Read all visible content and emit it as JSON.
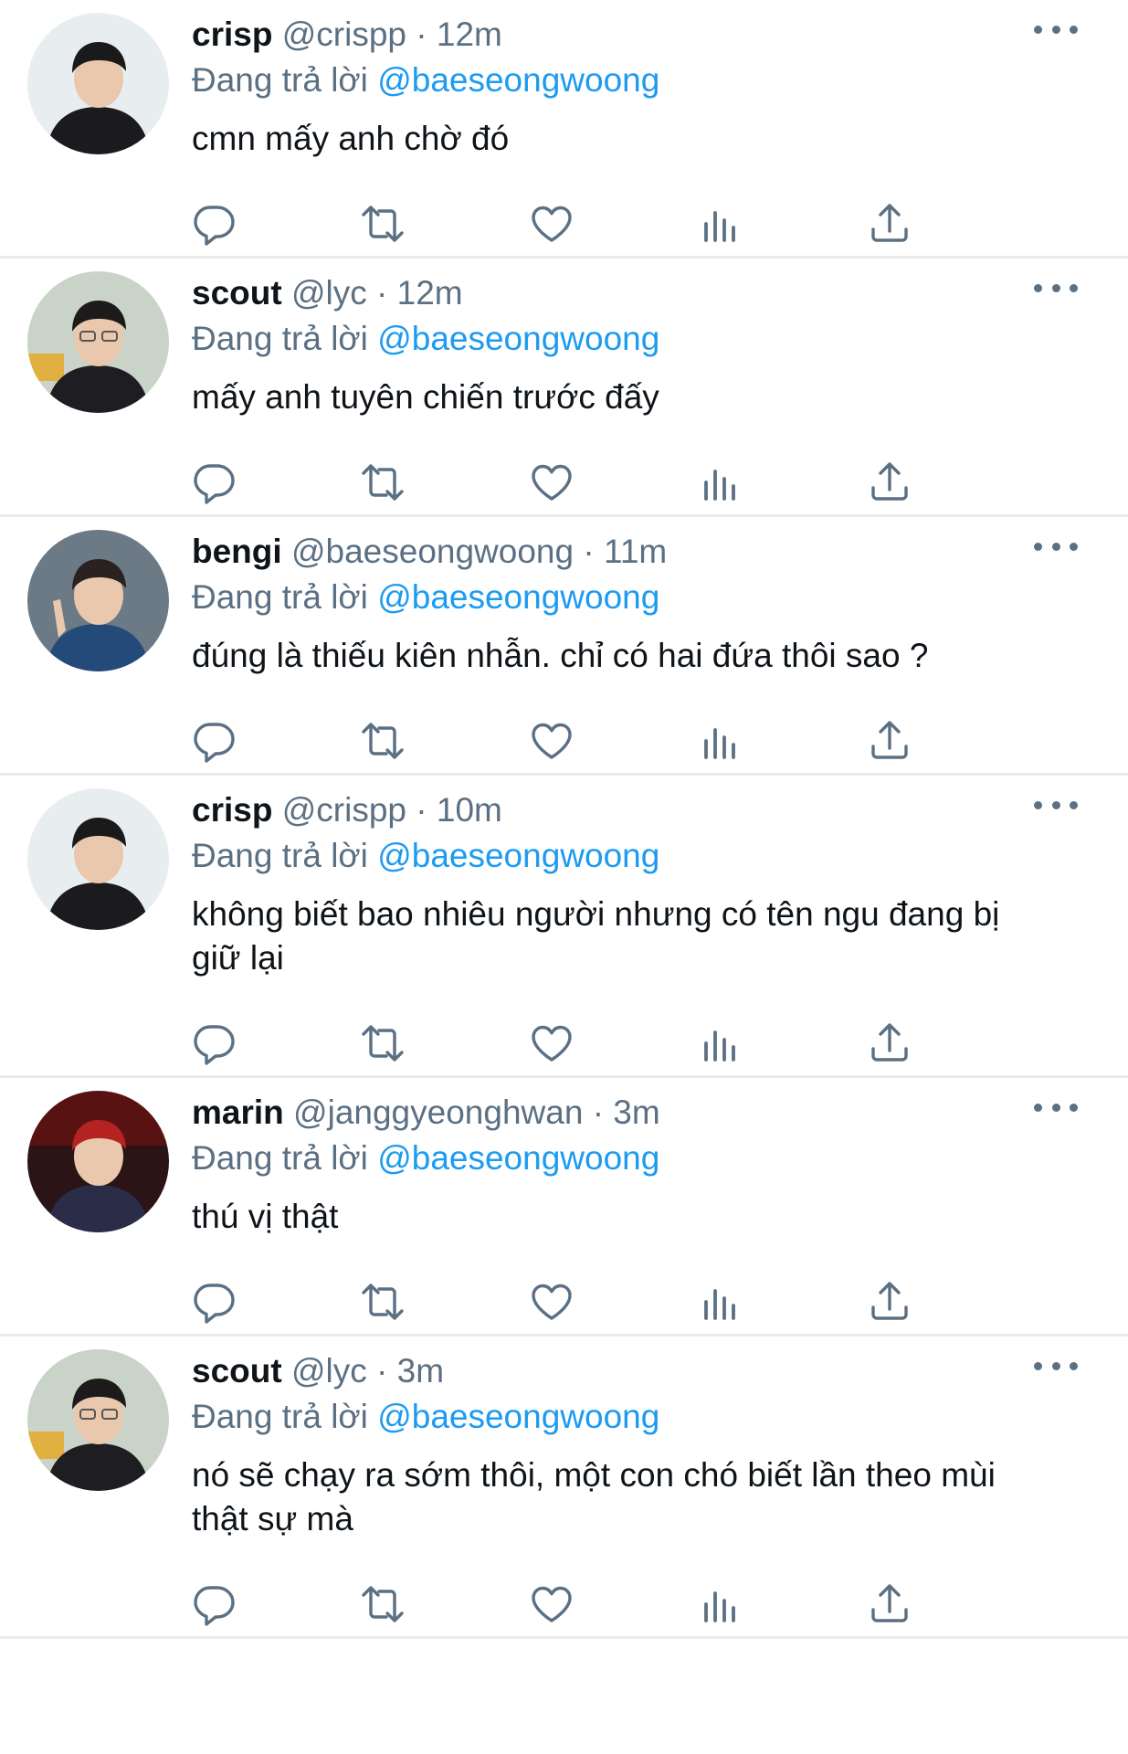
{
  "colors": {
    "mention": "#1d9bf0",
    "secondary_text": "#5b7083",
    "primary_text": "#0f1419",
    "divider": "#e8ebed"
  },
  "icons": [
    "reply-icon",
    "retweet-icon",
    "like-icon",
    "analytics-icon",
    "share-icon",
    "more-icon"
  ],
  "tweets": [
    {
      "name": "crisp",
      "handle": "@crispp",
      "separator": "·",
      "time": "12m",
      "reply_prefix": "Đang trả lời",
      "reply_to": "@baeseongwoong",
      "text": "cmn mấy anh chờ đó",
      "avatar": "crisp"
    },
    {
      "name": "scout",
      "handle": "@lyc",
      "separator": "·",
      "time": "12m",
      "reply_prefix": "Đang trả lời",
      "reply_to": "@baeseongwoong",
      "text": "mấy anh tuyên chiến trước đấy",
      "avatar": "scout"
    },
    {
      "name": "bengi",
      "handle": "@baeseongwoong",
      "separator": "·",
      "time": "11m",
      "reply_prefix": "Đang trả lời",
      "reply_to": "@baeseongwoong",
      "text": "đúng là thiếu kiên nhẫn. chỉ có hai đứa thôi sao ?",
      "avatar": "bengi"
    },
    {
      "name": "crisp",
      "handle": "@crispp",
      "separator": "·",
      "time": "10m",
      "reply_prefix": "Đang trả lời",
      "reply_to": "@baeseongwoong",
      "text": "không biết bao nhiêu người nhưng có tên ngu đang bị giữ lại",
      "avatar": "crisp"
    },
    {
      "name": "marin",
      "handle": "@janggyeonghwan",
      "separator": "·",
      "time": "3m",
      "reply_prefix": "Đang trả lời",
      "reply_to": "@baeseongwoong",
      "text": "thú vị thật",
      "avatar": "marin"
    },
    {
      "name": "scout",
      "handle": "@lyc",
      "separator": "·",
      "time": "3m",
      "reply_prefix": "Đang trả lời",
      "reply_to": "@baeseongwoong",
      "text": "nó sẽ chạy ra sớm thôi, một con chó biết lần theo mùi thật sự mà",
      "avatar": "scout"
    }
  ]
}
